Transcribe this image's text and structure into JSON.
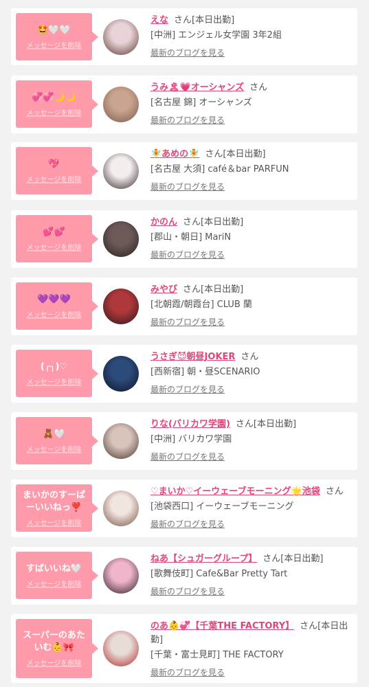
{
  "delete_label": "メッセージを削除",
  "blog_label": "最新のブログを見る",
  "san": "さん",
  "cards": [
    {
      "message": "🤩🤍🤍",
      "name": "えな",
      "status": "[本日出勤]",
      "shop": "[中洲] エンジェル女学園 3年2組",
      "avatar_colors": [
        "#e9d3d8",
        "#5b3a34"
      ]
    },
    {
      "message": "💞💞🌙🌙",
      "name": "うみ🏝💗オーシャンズ",
      "status": "",
      "shop": "[名古屋 錦] オーシャンズ",
      "avatar_colors": [
        "#c9a58f",
        "#7c5b4a"
      ]
    },
    {
      "message": "💖",
      "name": "🧚あめの🧚",
      "status": "[本日出勤]",
      "shop": "[名古屋 大須] café＆bar PARFUN",
      "avatar_colors": [
        "#f3eeee",
        "#3a2a2c"
      ]
    },
    {
      "message": "💕💕",
      "name": "かのん",
      "status": "[本日出勤]",
      "shop": "[郡山・朝日] MariN",
      "avatar_colors": [
        "#6c5a58",
        "#2a2222"
      ]
    },
    {
      "message": "💜💜💜",
      "name": "みやび",
      "status": "[本日出勤]",
      "shop": "[北朝霞/朝霞台] CLUB 蘭",
      "avatar_colors": [
        "#b0383c",
        "#2a1818"
      ]
    },
    {
      "message": "(╭╮)♡",
      "name": "うさぎ😈朝昼JOKER",
      "status": "",
      "shop": "[西新宿] 朝・昼SCENARIO",
      "avatar_colors": [
        "#2b4b7a",
        "#0e1526"
      ]
    },
    {
      "message": "🧸🤍",
      "name": "りな(バリカワ学園)",
      "status": "[本日出勤]",
      "shop": "[中洲] バリカワ学園",
      "avatar_colors": [
        "#d9c4bb",
        "#4a3630"
      ]
    },
    {
      "message": "まいかのすーぱーいいねっ❣️",
      "name": "♡まいか♡イーウェーブモーニング🌟池袋",
      "status": "",
      "shop": "[池袋西口] イーウェーブモーニング",
      "avatar_colors": [
        "#f1e5df",
        "#7a5040"
      ]
    },
    {
      "message": "すばいいね🤍",
      "name": "ねあ【シュガーグループ】",
      "status": "[本日出勤]",
      "shop": "[歌舞伎町] Cafe&Bar Pretty Tart",
      "avatar_colors": [
        "#f0b5cc",
        "#2a2026"
      ]
    },
    {
      "message": "スーパーのあたいむ👶🎀",
      "name": "のあ👶💞【千葉THE FACTORY】",
      "status": "[本日出勤]",
      "shop": "[千葉・富士見町] THE FACTORY",
      "avatar_colors": [
        "#e7dcd6",
        "#b02a2e"
      ]
    }
  ]
}
